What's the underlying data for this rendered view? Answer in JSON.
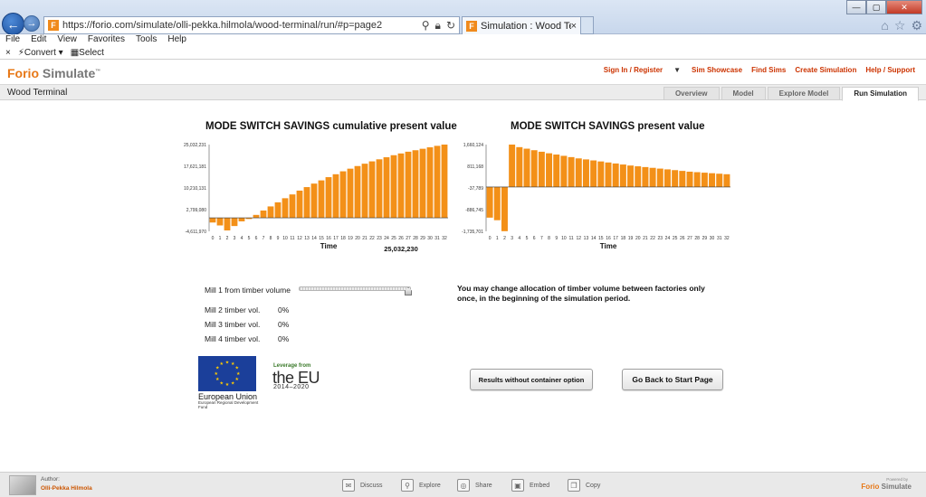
{
  "browser": {
    "url": "https://forio.com/simulate/olli-pekka.hilmola/wood-terminal/run/#p=page2",
    "tab_title": "Simulation : Wood Termina...",
    "favicon_letter": "F",
    "close_tab": "×"
  },
  "menu": [
    "File",
    "Edit",
    "View",
    "Favorites",
    "Tools",
    "Help"
  ],
  "commandbar": {
    "close": "×",
    "convert": "Convert",
    "select": "Select"
  },
  "site": {
    "logo_a": "Forio",
    "logo_b": "Simulate",
    "logo_tm": "™",
    "links": [
      "Sign In / Register",
      "Sim Showcase",
      "Find Sims",
      "Create Simulation",
      "Help / Support"
    ]
  },
  "project": {
    "name": "Wood Terminal",
    "tabs": [
      "Overview",
      "Model",
      "Explore Model",
      "Run Simulation"
    ],
    "active_tab": "Run Simulation"
  },
  "chart_data": [
    {
      "type": "bar",
      "title": "MODE SWITCH SAVINGS cumulative present value",
      "xlabel": "Time",
      "yticks": [
        "25,032,231",
        "17,621,181",
        "10,210,131",
        "2,799,080",
        "-4,611,970"
      ],
      "ylim": [
        -4611970,
        25032231
      ],
      "categories": [
        "0",
        "1",
        "2",
        "3",
        "4",
        "5",
        "6",
        "7",
        "8",
        "9",
        "10",
        "11",
        "12",
        "13",
        "14",
        "15",
        "16",
        "17",
        "18",
        "19",
        "20",
        "21",
        "22",
        "23",
        "24",
        "25",
        "26",
        "27",
        "28",
        "29",
        "30",
        "31",
        "32"
      ],
      "values": [
        -1600000,
        -2600000,
        -4300000,
        -2800000,
        -1200000,
        -400000,
        1000000,
        2500000,
        3900000,
        5300000,
        6700000,
        8000000,
        9300000,
        10500000,
        11700000,
        12800000,
        13900000,
        14900000,
        15900000,
        16800000,
        17700000,
        18500000,
        19300000,
        20000000,
        20700000,
        21400000,
        22000000,
        22600000,
        23100000,
        23600000,
        24100000,
        24600000,
        25032231
      ],
      "final_value_label": "25,032,230",
      "color": "#f39018"
    },
    {
      "type": "bar",
      "title": "MODE SWITCH SAVINGS present value",
      "xlabel": "Time",
      "yticks": [
        "1,660,124",
        "811,168",
        "-37,789",
        "-886,745",
        "-1,735,701"
      ],
      "ylim": [
        -1735701,
        1660124
      ],
      "categories": [
        "0",
        "1",
        "2",
        "3",
        "4",
        "5",
        "6",
        "7",
        "8",
        "9",
        "10",
        "11",
        "12",
        "13",
        "14",
        "15",
        "16",
        "17",
        "18",
        "19",
        "20",
        "21",
        "22",
        "23",
        "24",
        "25",
        "26",
        "27",
        "28",
        "29",
        "30",
        "31",
        "32"
      ],
      "values": [
        -1200000,
        -1300000,
        -1730000,
        1660000,
        1560000,
        1500000,
        1440000,
        1380000,
        1320000,
        1270000,
        1220000,
        1170000,
        1120000,
        1080000,
        1040000,
        1000000,
        960000,
        920000,
        880000,
        840000,
        810000,
        780000,
        750000,
        720000,
        690000,
        660000,
        630000,
        600000,
        580000,
        560000,
        540000,
        520000,
        500000
      ],
      "color": "#f39018"
    }
  ],
  "controls": {
    "mill1_label": "Mill 1 from timber volume",
    "mill1_fraction": 1.0,
    "mills": [
      {
        "label": "Mill 2 timber vol.",
        "value": "0%"
      },
      {
        "label": "Mill 3 timber vol.",
        "value": "0%"
      },
      {
        "label": "Mill 4 timber vol.",
        "value": "0%"
      }
    ],
    "notice": "You may change allocation of timber volume between factories only once, in the beginning of the simulation period."
  },
  "logos": {
    "eu_name": "European Union",
    "eu_fund": "European Regional Development Fund",
    "lev_top": "Leverage from",
    "lev_mid": "the EU",
    "lev_bot": "2014–2020"
  },
  "buttons": {
    "results": "Results without container option",
    "back": "Go Back to Start Page"
  },
  "footer": {
    "author_label": "Author:",
    "author_name": "Olli-Pekka Hilmola",
    "actions": [
      "Discuss",
      "Explore",
      "Share",
      "Embed",
      "Copy"
    ],
    "powered_by": "Powered by",
    "powered_a": "Forio",
    "powered_b": "Simulate"
  }
}
